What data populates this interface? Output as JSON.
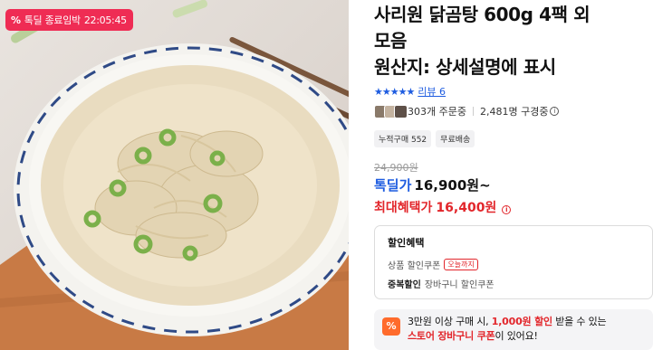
{
  "badge": {
    "label": "톡딜 종료임박",
    "timer": "22:05:45",
    "icon": "percent-icon"
  },
  "product": {
    "title_line1": "사리원 닭곰탕 600g 4팩 외",
    "title_line2": "모음",
    "title_line3": "원산지: 상세설명에 표시"
  },
  "rating": {
    "stars": "★★★★★",
    "review_label": "리뷰 6"
  },
  "buyers": {
    "orders": "303개 주문중",
    "subscribers": "2,481명 구경중"
  },
  "tags": [
    "누적구매 552",
    "무료배송"
  ],
  "price": {
    "original": "24,900원",
    "deal_label": "톡딜가",
    "deal_value": "16,900원~",
    "max_label": "최대혜택가",
    "max_value": "16,400원"
  },
  "discount": {
    "title": "할인혜택",
    "line1_label": "상품 할인쿠폰",
    "line1_chip": "오늘까지",
    "line2_label": "중복할인",
    "line2_value": "장바구니 할인쿠폰"
  },
  "promo": {
    "icon": "%",
    "part1": "3만원 이상 구매 시, ",
    "amount": "1,000원 할인",
    "part2": " 받을 수 있는",
    "coupon": "스토어 장바구니 쿠폰",
    "part3": "이 있어요!"
  },
  "colors": {
    "deal_red": "#ef2c54",
    "accent_blue": "#1e5ce0",
    "price_red": "#e2262b"
  }
}
